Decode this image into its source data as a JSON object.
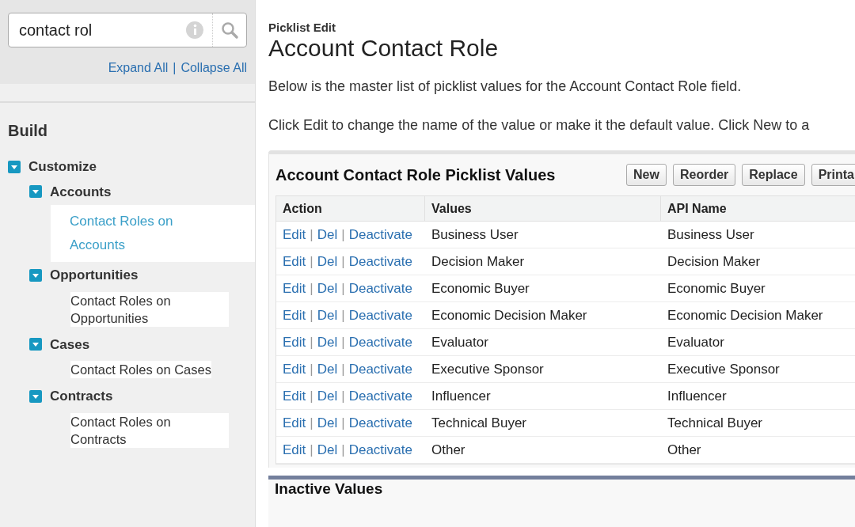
{
  "sidebar": {
    "search": {
      "value": "contact rol"
    },
    "links": [
      "Expand All",
      "|",
      "Collapse All"
    ],
    "section_title": "Build",
    "tree": [
      {
        "label": "Customize",
        "expanded": true,
        "children": [
          {
            "label": "Accounts",
            "expanded": true,
            "children": [
              {
                "label": "Contact Roles on Accounts",
                "selected": true
              }
            ]
          },
          {
            "label": "Opportunities",
            "expanded": true,
            "children": [
              {
                "label": "Contact Roles on Opportunities",
                "selected": false
              }
            ]
          },
          {
            "label": "Cases",
            "expanded": true,
            "children": [
              {
                "label": "Contact Roles on Cases",
                "selected": false
              }
            ]
          },
          {
            "label": "Contracts",
            "expanded": true,
            "children": [
              {
                "label": "Contact Roles on Contracts",
                "selected": false
              }
            ]
          }
        ]
      }
    ]
  },
  "page": {
    "subtitle": "Picklist Edit",
    "title": "Account Contact Role",
    "description": "Below is the master list of picklist values for the Account Contact Role field.",
    "instruction": "Click Edit to change the name of the value or make it the default value. Click New to a"
  },
  "picklist": {
    "title": "Account Contact Role Picklist Values",
    "buttons": [
      "New",
      "Reorder",
      "Replace",
      "Printa"
    ],
    "columns": [
      "Action",
      "Values",
      "API Name"
    ],
    "rows": [
      {
        "actions": [
          "Edit",
          "|",
          "Del",
          "|",
          "Deactivate"
        ],
        "value": "Business User",
        "api_name": "Business User"
      },
      {
        "actions": [
          "Edit",
          "|",
          "Del",
          "|",
          "Deactivate"
        ],
        "value": "Decision Maker",
        "api_name": "Decision Maker"
      },
      {
        "actions": [
          "Edit",
          "|",
          "Del",
          "|",
          "Deactivate"
        ],
        "value": "Economic Buyer",
        "api_name": "Economic Buyer"
      },
      {
        "actions": [
          "Edit",
          "|",
          "Del",
          "|",
          "Deactivate"
        ],
        "value": "Economic Decision Maker",
        "api_name": "Economic Decision Maker"
      },
      {
        "actions": [
          "Edit",
          "|",
          "Del",
          "|",
          "Deactivate"
        ],
        "value": "Evaluator",
        "api_name": "Evaluator"
      },
      {
        "actions": [
          "Edit",
          "|",
          "Del",
          "|",
          "Deactivate"
        ],
        "value": "Executive Sponsor",
        "api_name": "Executive Sponsor"
      },
      {
        "actions": [
          "Edit",
          "|",
          "Del",
          "|",
          "Deactivate"
        ],
        "value": "Influencer",
        "api_name": "Influencer"
      },
      {
        "actions": [
          "Edit",
          "|",
          "Del",
          "|",
          "Deactivate"
        ],
        "value": "Technical Buyer",
        "api_name": "Technical Buyer"
      },
      {
        "actions": [
          "Edit",
          "|",
          "Del",
          "|",
          "Deactivate"
        ],
        "value": "Other",
        "api_name": "Other"
      }
    ]
  },
  "inactive": {
    "title": "Inactive Values"
  }
}
